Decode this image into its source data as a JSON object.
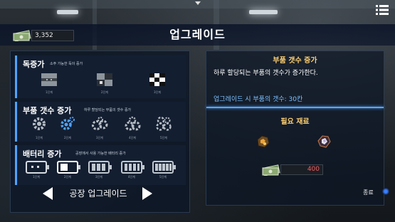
{
  "header": {
    "title": "업그레이드",
    "currency_amount": "3,352"
  },
  "sections": [
    {
      "title": "독증가",
      "desc": "소주 가능한 독이 증가",
      "levels": [
        "1단계",
        "2단계",
        "3단계"
      ]
    },
    {
      "title": "부품 갯수 증가",
      "desc": "하루 할당되는 부품의 갯수 증가",
      "levels": [
        "1단계",
        "2단계",
        "3단계",
        "4단계",
        "5단계"
      ]
    },
    {
      "title": "배터리 증가",
      "desc": "공장에서 사용 가능한 배터리 증가",
      "levels": [
        "1단계",
        "2단계",
        "3단계",
        "4단계",
        "5단계"
      ]
    }
  ],
  "nav": {
    "label": "공장 업그레이드"
  },
  "detail": {
    "title": "부품 갯수 증가",
    "description": "하루 할당되는 부품의 갯수가 증가한다.",
    "stat": "업그레이드 시 부품의 갯수: 30칸",
    "required_title": "필요 재료",
    "cost": "400"
  },
  "footer": {
    "exit_label": "종료"
  },
  "colors": {
    "accent": "#4ea3ff",
    "gold": "#ffd071",
    "cost_red": "#ff5a5a"
  }
}
